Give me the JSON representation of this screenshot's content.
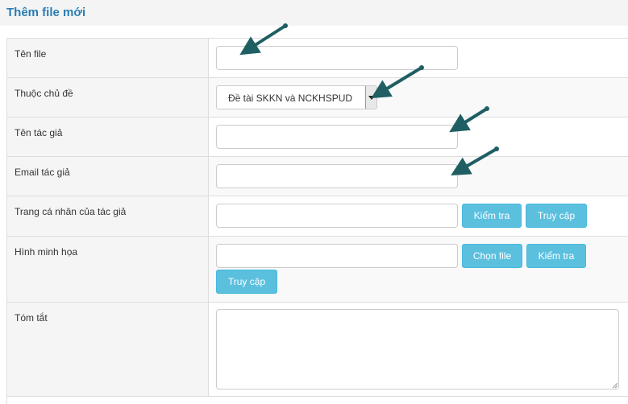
{
  "header": {
    "title": "Thêm file mới"
  },
  "form": {
    "file_name": {
      "label": "Tên file",
      "value": ""
    },
    "topic": {
      "label": "Thuộc chủ đề",
      "selected": "Đề tài SKKN và NCKHSPUD"
    },
    "author_name": {
      "label": "Tên tác giả",
      "value": ""
    },
    "author_email": {
      "label": "Email tác giả",
      "value": ""
    },
    "author_page": {
      "label": "Trang cá nhân của tác giả",
      "value": "",
      "check_label": "Kiểm tra",
      "visit_label": "Truy cập"
    },
    "illustration": {
      "label": "Hình minh họa",
      "value": "",
      "choose_label": "Chọn file",
      "check_label": "Kiểm tra",
      "visit_label": "Truy cập"
    },
    "summary": {
      "label": "Tóm tắt",
      "value": ""
    }
  },
  "colors": {
    "title": "#2a7db3",
    "button": "#5bc0de",
    "arrow": "#1f5f63"
  }
}
